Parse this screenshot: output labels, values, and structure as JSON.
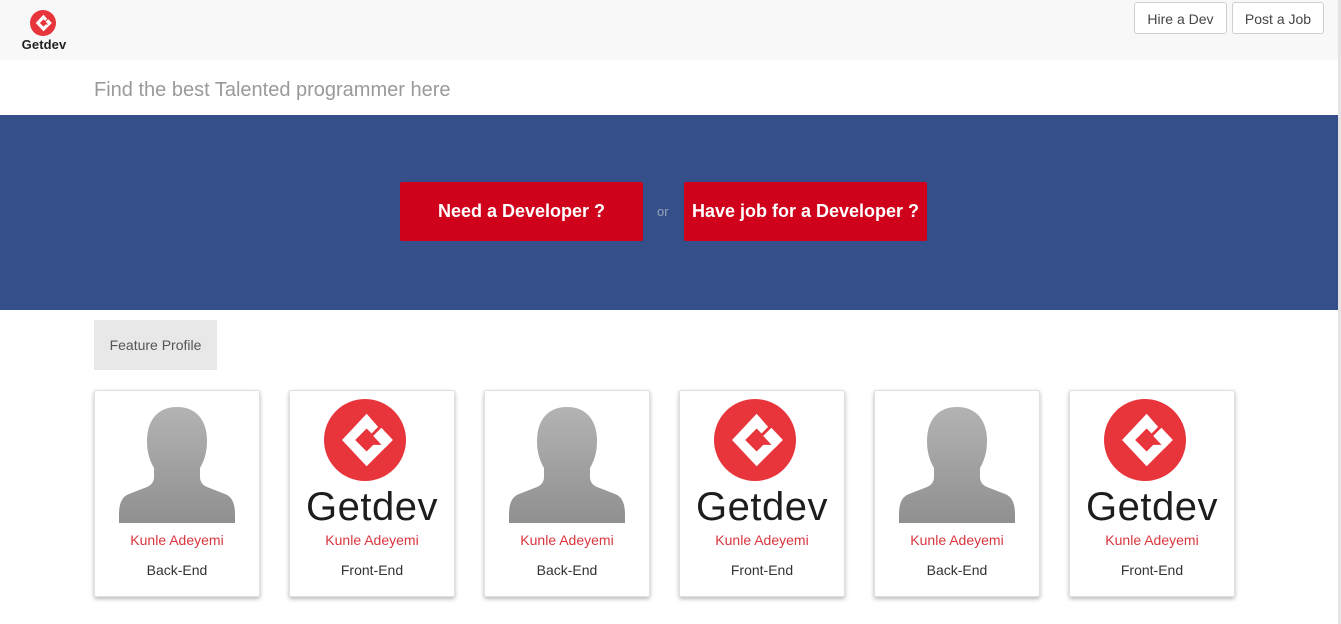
{
  "header": {
    "brand_name": "Getdev",
    "brand_icon": "getdev-logo-icon",
    "nav": [
      {
        "label": "Hire a Dev"
      },
      {
        "label": "Post a Job"
      }
    ]
  },
  "tagline": "Find the best Talented programmer here",
  "hero": {
    "primary_cta": "Need a Developer ?",
    "separator": "or",
    "secondary_cta": "Have job for a Developer ?",
    "background_color": "#344f8a",
    "button_color": "#d0021b"
  },
  "feature_tab": "Feature Profile",
  "profiles": [
    {
      "name": "Kunle Adeyemi",
      "role": "Back-End",
      "image": "default-avatar-icon"
    },
    {
      "name": "Kunle Adeyemi",
      "role": "Front-End",
      "image": "getdev-logo",
      "logo_text": "Getdev"
    },
    {
      "name": "Kunle Adeyemi",
      "role": "Back-End",
      "image": "default-avatar-icon"
    },
    {
      "name": "Kunle Adeyemi",
      "role": "Front-End",
      "image": "getdev-logo",
      "logo_text": "Getdev"
    },
    {
      "name": "Kunle Adeyemi",
      "role": "Back-End",
      "image": "default-avatar-icon"
    },
    {
      "name": "Kunle Adeyemi",
      "role": "Front-End",
      "image": "getdev-logo",
      "logo_text": "Getdev"
    }
  ],
  "colors": {
    "accent": "#d9363e",
    "logo_red": "#e8343b"
  }
}
